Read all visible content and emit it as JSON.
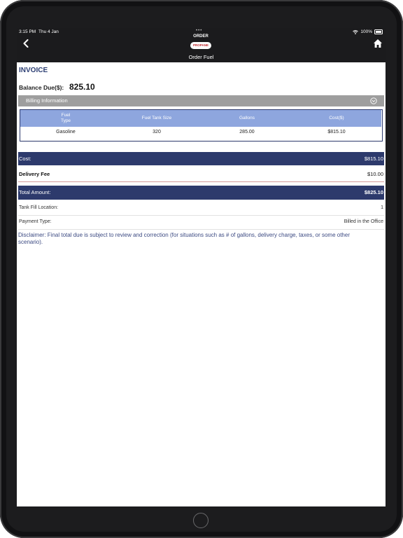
{
  "status_bar": {
    "time": "3:15 PM",
    "date": "Thu 4 Jan",
    "battery": "100%"
  },
  "nav": {
    "title": "Order Fuel",
    "logo_top": "ORDER",
    "logo_bottom": "PROPANE"
  },
  "invoice": {
    "title": "INVOICE",
    "balance_label": "Balance Due($):",
    "balance_value": "825.10"
  },
  "billing": {
    "section_label": "Billing Information",
    "columns": [
      "Fuel\nType",
      "Fuel Tank Size",
      "Gallons",
      "Cost($)"
    ],
    "rows": [
      [
        "Gasoline",
        "320",
        "285.00",
        "$815.10"
      ]
    ]
  },
  "summary": {
    "cost_label": "Cost:",
    "cost_value": "$815.10",
    "delivery_fee_label": "Delivery Fee",
    "delivery_fee_value": "$10.00",
    "total_label": "Total Amount:",
    "total_value": "$825.10",
    "tank_fill_label": "Tank Fill Location:",
    "tank_fill_value": "1",
    "payment_type_label": "Payment Type:",
    "payment_type_value": "Billed in the Office"
  },
  "disclaimer": "Disclaimer: Final total due is subject to review and correction (for situations such as # of gallons, delivery charge, taxes, or some other scenario).",
  "colors": {
    "navy": "#2d3a6c",
    "header_blue": "#8ea6de",
    "gray_bar": "#9e9e9e",
    "brand_red": "#c0282d"
  }
}
